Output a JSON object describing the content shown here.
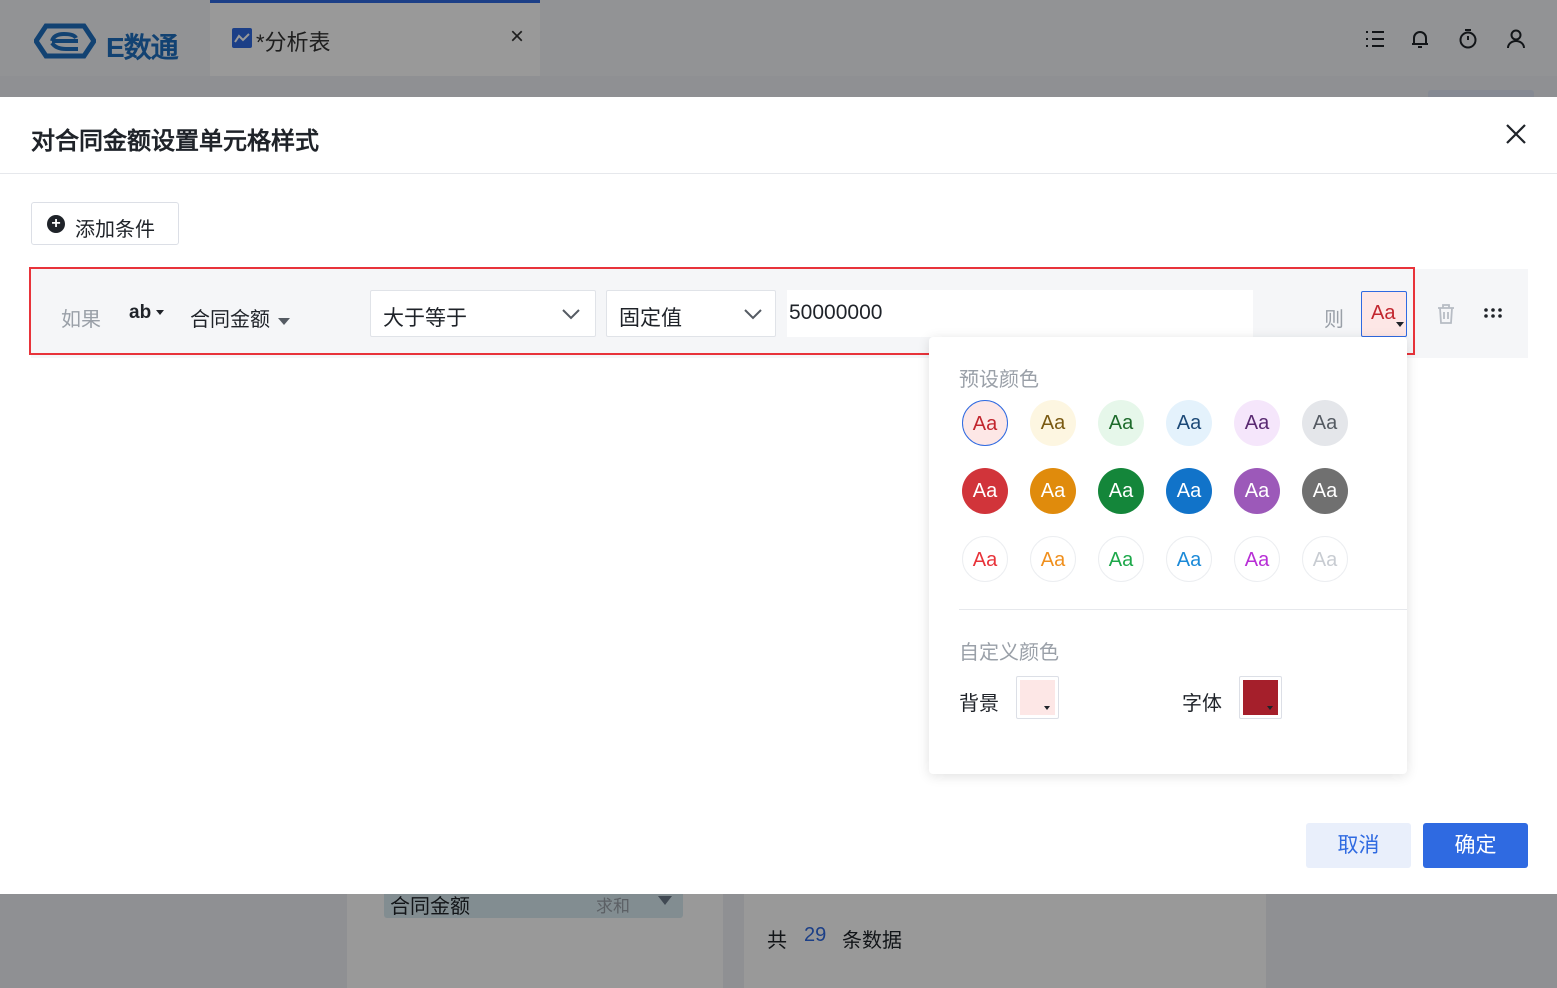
{
  "app": {
    "brand": "E数通"
  },
  "tab": {
    "label": "*分析表",
    "close": "×"
  },
  "background": {
    "field_chip": "合同金额",
    "field_agg": "求和",
    "count_prefix": "共",
    "count_value": "29",
    "count_suffix": "条数据"
  },
  "modal": {
    "title": "对合同金额设置单元格样式",
    "add_condition": "添加条件",
    "row": {
      "if_label": "如果",
      "type_label": "ab",
      "field": "合同金额",
      "operator": "大于等于",
      "value_type": "固定值",
      "value": "50000000",
      "then_label": "则",
      "style_preview": "Aa"
    },
    "popup": {
      "preset_title": "预设颜色",
      "custom_title": "自定义颜色",
      "swatch_text": "Aa",
      "bg_label": "背景",
      "font_label": "字体",
      "bg_color": "#fde7e6",
      "font_color": "#a51f2b",
      "presets": [
        [
          {
            "bg": "#fde7e6",
            "fg": "#c2262e",
            "border": "#2f6ae1"
          },
          {
            "bg": "#fdf6e1",
            "fg": "#7a5a12"
          },
          {
            "bg": "#e6f7ea",
            "fg": "#1e6b2c"
          },
          {
            "bg": "#e4f2fc",
            "fg": "#1d4a78"
          },
          {
            "bg": "#f5e6fb",
            "fg": "#5a2a72"
          },
          {
            "bg": "#e4e6ea",
            "fg": "#555b63"
          }
        ],
        [
          {
            "bg": "#d1343a",
            "fg": "#ffffff"
          },
          {
            "bg": "#e08b0c",
            "fg": "#ffffff"
          },
          {
            "bg": "#14863a",
            "fg": "#ffffff"
          },
          {
            "bg": "#1173c9",
            "fg": "#ffffff"
          },
          {
            "bg": "#9c59b9",
            "fg": "#ffffff"
          },
          {
            "bg": "#707070",
            "fg": "#ffffff"
          }
        ],
        [
          {
            "bg": "#ffffff",
            "fg": "#e8333a",
            "border": "#eceef1"
          },
          {
            "bg": "#ffffff",
            "fg": "#f0901e",
            "border": "#eceef1"
          },
          {
            "bg": "#ffffff",
            "fg": "#1da84a",
            "border": "#eceef1"
          },
          {
            "bg": "#ffffff",
            "fg": "#1c8ad8",
            "border": "#eceef1"
          },
          {
            "bg": "#ffffff",
            "fg": "#b82fd6",
            "border": "#eceef1"
          },
          {
            "bg": "#ffffff",
            "fg": "#c8ccd2",
            "border": "#eceef1"
          }
        ]
      ]
    },
    "cancel": "取消",
    "confirm": "确定"
  }
}
